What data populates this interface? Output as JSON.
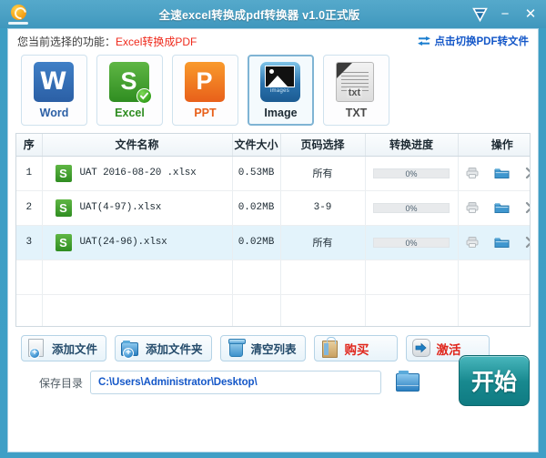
{
  "window": {
    "title": "全速excel转换成pdf转换器 v1.0正式版",
    "logo_icon": "convert-circular-arrow-logo",
    "controls": [
      {
        "name": "shield-dropdown-icon",
        "glyph": "shield"
      },
      {
        "name": "minimize-button",
        "glyph": "−"
      },
      {
        "name": "close-button",
        "glyph": "✕"
      }
    ]
  },
  "function_line": {
    "label": "您当前选择的功能：",
    "value": "Excel转换成PDF",
    "value_color": "#ef2a1c",
    "switch_link": "点击切换PDF转文件",
    "switch_link_icon": "two-way-arrows-icon",
    "switch_link_color": "#1457c8"
  },
  "formats": [
    {
      "id": "word",
      "label": "Word",
      "label_color": "#2b5fa5",
      "glyph": "W",
      "selected": false,
      "hover": false
    },
    {
      "id": "excel",
      "label": "Excel",
      "label_color": "#2f8d21",
      "glyph": "S",
      "selected": true,
      "hover": false
    },
    {
      "id": "ppt",
      "label": "PPT",
      "label_color": "#e8601a",
      "glyph": "P",
      "selected": false,
      "hover": false
    },
    {
      "id": "image",
      "label": "Image",
      "label_color": "#1d2a33",
      "caption": "images",
      "selected": false,
      "hover": true
    },
    {
      "id": "txt",
      "label": "TXT",
      "label_color": "#4a4a4a",
      "glyph": "txt",
      "selected": false,
      "hover": false
    }
  ],
  "table": {
    "headers": [
      "序",
      "文件名称",
      "文件大小",
      "页码选择",
      "转换进度",
      "操作"
    ],
    "rows": [
      {
        "index": "1",
        "file_icon": "excel-file-icon",
        "name": "UAT 2016-08-20 .xlsx",
        "size": "0.53MB",
        "pages": "所有",
        "progress_text": "0%",
        "progress_pct": 0,
        "selected": false,
        "actions": [
          "preview-icon",
          "open-folder-icon",
          "remove-icon"
        ]
      },
      {
        "index": "2",
        "file_icon": "excel-file-icon",
        "name": "UAT(4-97).xlsx",
        "size": "0.02MB",
        "pages": "3-9",
        "progress_text": "0%",
        "progress_pct": 0,
        "selected": false,
        "actions": [
          "preview-icon",
          "open-folder-icon",
          "remove-icon"
        ]
      },
      {
        "index": "3",
        "file_icon": "excel-file-icon",
        "name": "UAT(24-96).xlsx",
        "size": "0.02MB",
        "pages": "所有",
        "progress_text": "0%",
        "progress_pct": 0,
        "selected": true,
        "actions": [
          "preview-icon",
          "open-folder-icon",
          "remove-icon"
        ]
      }
    ],
    "empty_rows": 2
  },
  "buttons": [
    {
      "id": "add-file",
      "label": "添加文件",
      "icon": "add-file-icon",
      "red": false
    },
    {
      "id": "add-folder",
      "label": "添加文件夹",
      "icon": "add-folder-icon",
      "red": false
    },
    {
      "id": "clear-list",
      "label": "清空列表",
      "icon": "trash-icon",
      "red": false
    },
    {
      "id": "purchase",
      "label": "购买",
      "icon": "shopping-bag-icon",
      "red": true
    },
    {
      "id": "activate",
      "label": "激活",
      "icon": "blue-arrow-icon",
      "red": true
    }
  ],
  "save": {
    "label": "保存目录",
    "path": "C:\\Users\\Administrator\\Desktop\\",
    "path_color": "#1457c8",
    "browse_icon": "folder-browse-icon",
    "start_label": "开始",
    "start_color": "#18898f"
  }
}
